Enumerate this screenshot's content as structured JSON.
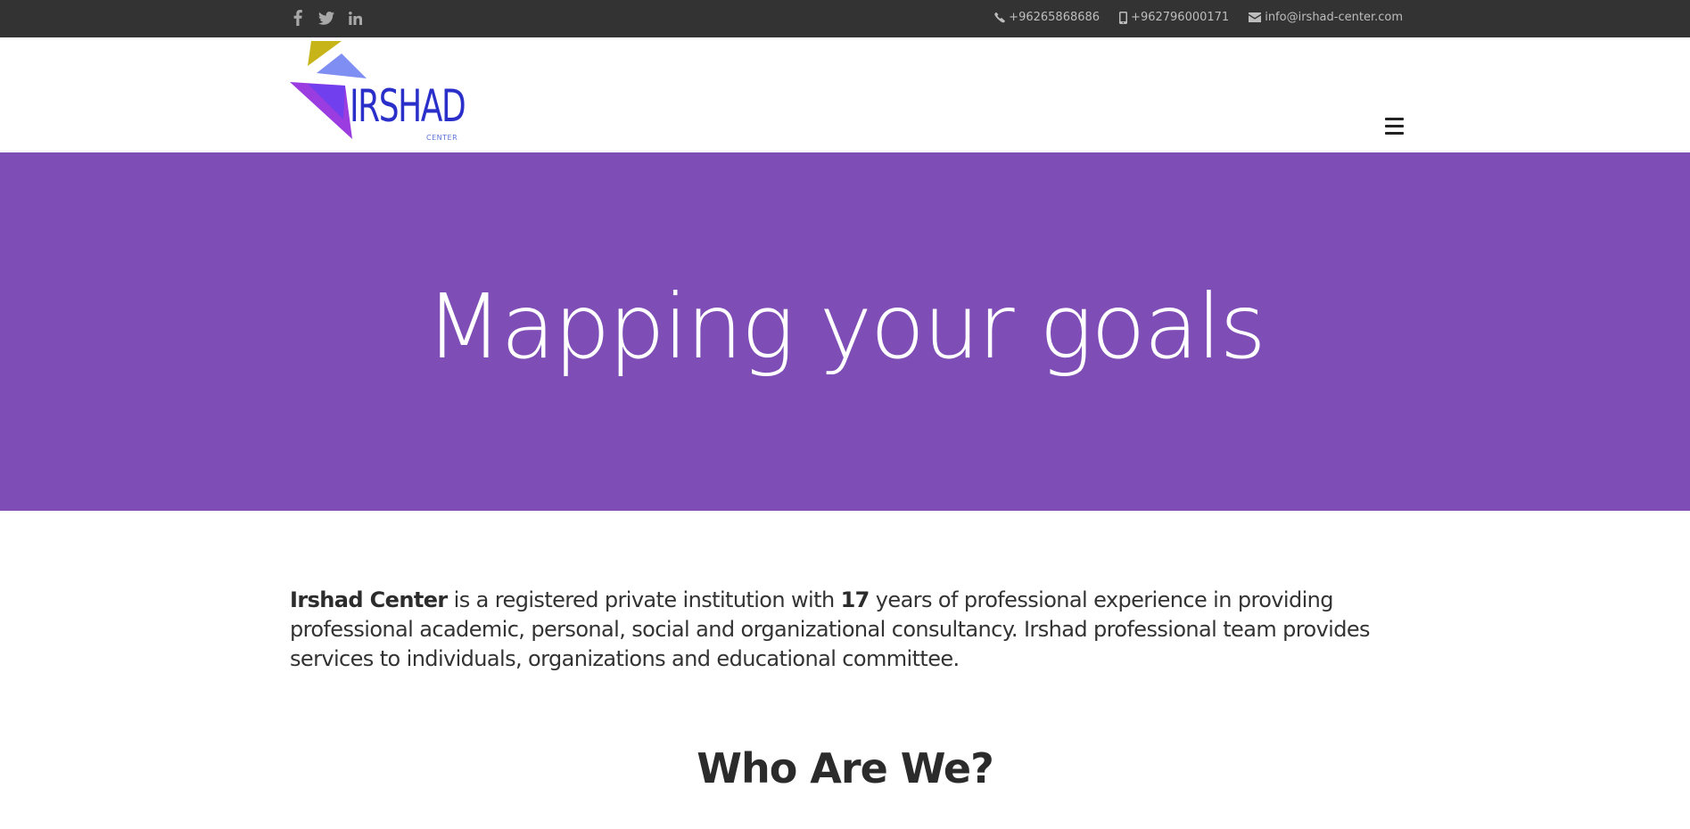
{
  "topbar": {
    "social": [
      {
        "name": "facebook-icon"
      },
      {
        "name": "twitter-icon"
      },
      {
        "name": "linkedin-icon"
      }
    ],
    "phone": "+96265868686",
    "mobile": "+962796000171",
    "email": "info@irshad-center.com"
  },
  "header": {
    "logo_text": "IRSHAD",
    "logo_sub": "CENTER",
    "menu_icon": "hamburger-icon"
  },
  "hero": {
    "title": "Mapping your goals",
    "background": "#7e4db6"
  },
  "intro": {
    "name": "Irshad Center",
    "text_1": " is a registered private institution with ",
    "years": "17",
    "text_2": " years of professional experience in providing professional academic, personal, social and organizational consultancy. Irshad professional team provides services to individuals, organizations and educational committee."
  },
  "section": {
    "heading": "Who Are We?"
  },
  "colors": {
    "topbar": "#333333",
    "accent": "#7e4db6",
    "logo_blue": "#2b2fc9"
  }
}
